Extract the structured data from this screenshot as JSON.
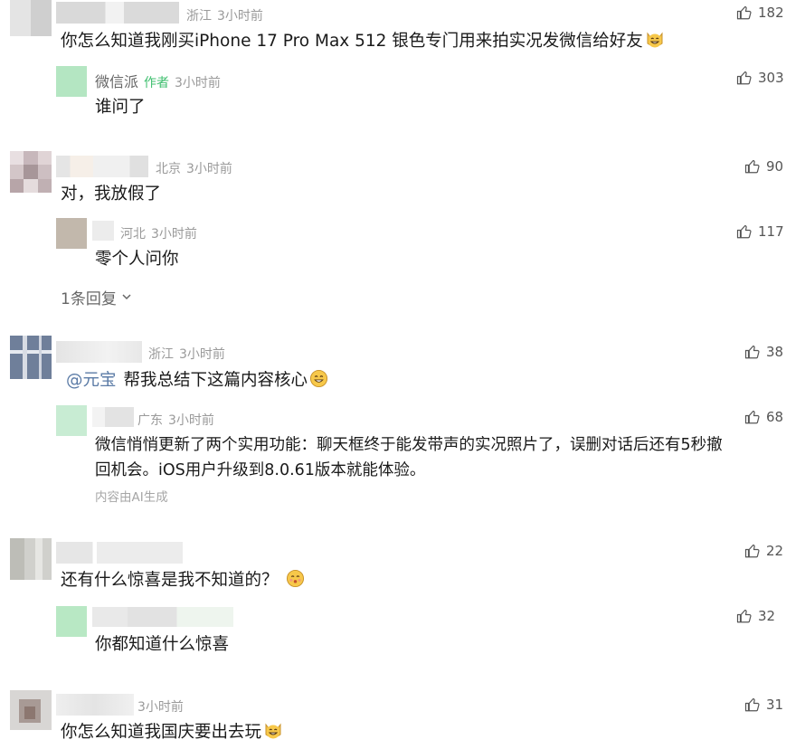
{
  "colors": {
    "accent_green": "#3fbf6f",
    "mention_blue": "#5b7ba6",
    "meta_gray": "#9a9a9a"
  },
  "comments": [
    {
      "region": "浙江",
      "time": "3小时前",
      "likes": "182",
      "text": "你怎么知道我刚买iPhone 17 Pro Max 512 银色专门用来拍实况发微信给好友",
      "emoji": "cat-grin-emoji"
    },
    {
      "reply": true,
      "nickname": "微信派",
      "author_tag": "作者",
      "time": "3小时前",
      "likes": "303",
      "text": "谁问了"
    },
    {
      "region": "北京",
      "time": "3小时前",
      "likes": "90",
      "text": "对，我放假了"
    },
    {
      "reply": true,
      "region": "河北",
      "time": "3小时前",
      "likes": "117",
      "text": "零个人问你"
    },
    {
      "expand_label": "1条回复"
    },
    {
      "region": "浙江",
      "time": "3小时前",
      "likes": "38",
      "mention": "@元宝",
      "text": "帮我总结下这篇内容核心",
      "emoji": "grin-emoji"
    },
    {
      "reply": true,
      "region": "广东",
      "time": "3小时前",
      "likes": "68",
      "text_line1": "微信悄悄更新了两个实用功能：聊天框终于能发带声的实况照片了，误删对话后还有5秒撤",
      "text_line2": "回机会。iOS用户升级到8.0.61版本就能体验。",
      "ai_note": "内容由AI生成"
    },
    {
      "time": "",
      "likes": "22",
      "text": "还有什么惊喜是我不知道的？",
      "emoji": "kiss-emoji"
    },
    {
      "reply": true,
      "time": "",
      "likes": "32",
      "text": "你都知道什么惊喜"
    },
    {
      "time": "3小时前",
      "likes": "31",
      "text": "你怎么知道我国庆要出去玩",
      "emoji": "cat-grin-emoji"
    }
  ]
}
